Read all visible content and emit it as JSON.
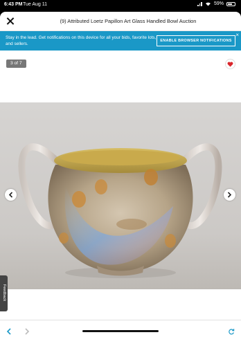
{
  "status_bar": {
    "time": "6:43 PM",
    "date": "Tue Aug 11",
    "battery": "59%"
  },
  "header": {
    "title": "(9) Attributed Loetz Papillon Art Glass Handled Bowl Auction"
  },
  "banner": {
    "text": "Stay in the lead. Get notifications on this device for all your bids, favorite lots, and sellers.",
    "button_label": "ENABLE BROWSER NOTIFICATIONS",
    "close_glyph": "×",
    "background": "#1a98c7"
  },
  "gallery": {
    "counter": "3 of 7"
  },
  "feedback": {
    "label": "Feedback"
  },
  "icons": {
    "close": "close-icon",
    "heart": "heart-icon",
    "prev": "chevron-left-icon",
    "next": "chevron-right-icon",
    "back": "back-arrow-icon",
    "forward": "forward-arrow-icon",
    "reload": "reload-icon"
  },
  "colors": {
    "accent": "#1a98c7",
    "heart": "#d9262c"
  }
}
